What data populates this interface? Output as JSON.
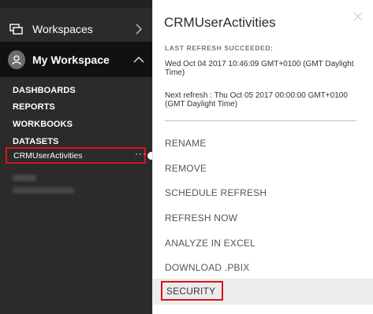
{
  "nav": {
    "workspaces_label": "Workspaces",
    "my_workspace_label": "My Workspace",
    "sections": {
      "dashboards": "DASHBOARDS",
      "reports": "REPORTS",
      "workbooks": "WORKBOOKS",
      "datasets": "DATASETS"
    },
    "selected_dataset": "CRMUserActivities"
  },
  "flyout": {
    "title": "CRMUserActivities",
    "refresh_header": "LAST REFRESH SUCCEEDED:",
    "last_refresh": "Wed Oct 04 2017 10:46:09 GMT+0100 (GMT Daylight Time)",
    "next_refresh": "Next refresh : Thu Oct 05 2017 00:00:00 GMT+0100 (GMT Daylight Time)",
    "menu": {
      "rename": "RENAME",
      "remove": "REMOVE",
      "schedule_refresh": "SCHEDULE REFRESH",
      "refresh_now": "REFRESH NOW",
      "analyze_excel": "ANALYZE IN EXCEL",
      "download_pbix": "DOWNLOAD .PBIX",
      "security": "SECURITY"
    }
  },
  "icons": {
    "workspaces": "workspaces-icon",
    "avatar": "user-avatar-icon",
    "chevron_right": "chevron-right-icon",
    "chevron_up": "chevron-up-icon",
    "ellipsis": "more-options-icon",
    "close": "close-icon"
  },
  "colors": {
    "nav_bg": "#2b2b2b",
    "nav_selected_bg": "#111111",
    "highlight_border": "#d6161b",
    "flyout_bg": "#ffffff",
    "hover_bg": "#ececec"
  }
}
